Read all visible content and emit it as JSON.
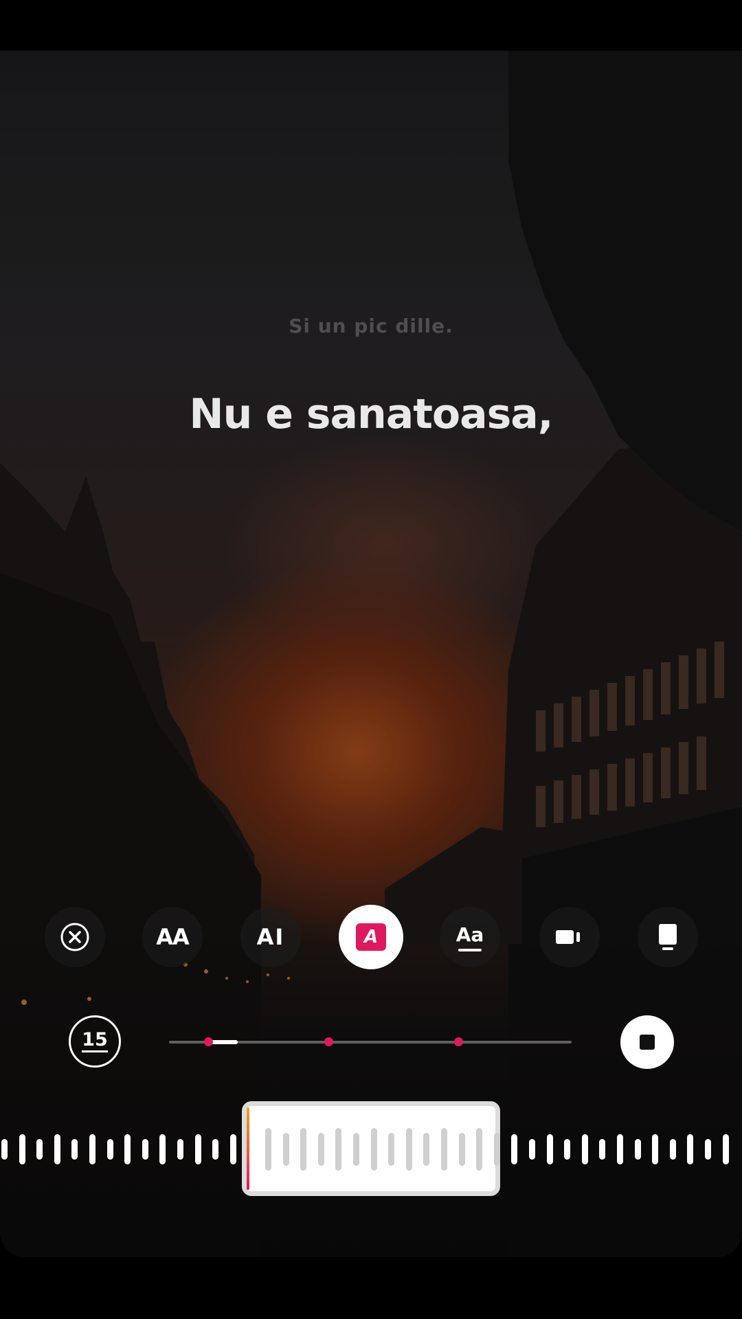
{
  "lyrics": {
    "previous_line": "Si un pic dille.",
    "current_line": "Nu e sanatoasa,"
  },
  "style_options": [
    {
      "id": "close",
      "icon": "close-circle-icon",
      "label": ""
    },
    {
      "id": "style-aa",
      "icon": "text-style-icon",
      "label": "AA"
    },
    {
      "id": "style-ai",
      "icon": "text-cursor-icon",
      "label": "AI"
    },
    {
      "id": "style-a",
      "icon": "text-highlight-icon",
      "label": "A",
      "selected": true
    },
    {
      "id": "style-aa-underline",
      "icon": "text-underline-icon",
      "label": "Aa"
    },
    {
      "id": "video",
      "icon": "video-icon",
      "label": ""
    },
    {
      "id": "card",
      "icon": "card-icon",
      "label": ""
    }
  ],
  "player": {
    "duration_label": "15",
    "progress": 0.12
  },
  "colors": {
    "accent": "#e0195f",
    "playhead_top": "#f4a21e"
  }
}
